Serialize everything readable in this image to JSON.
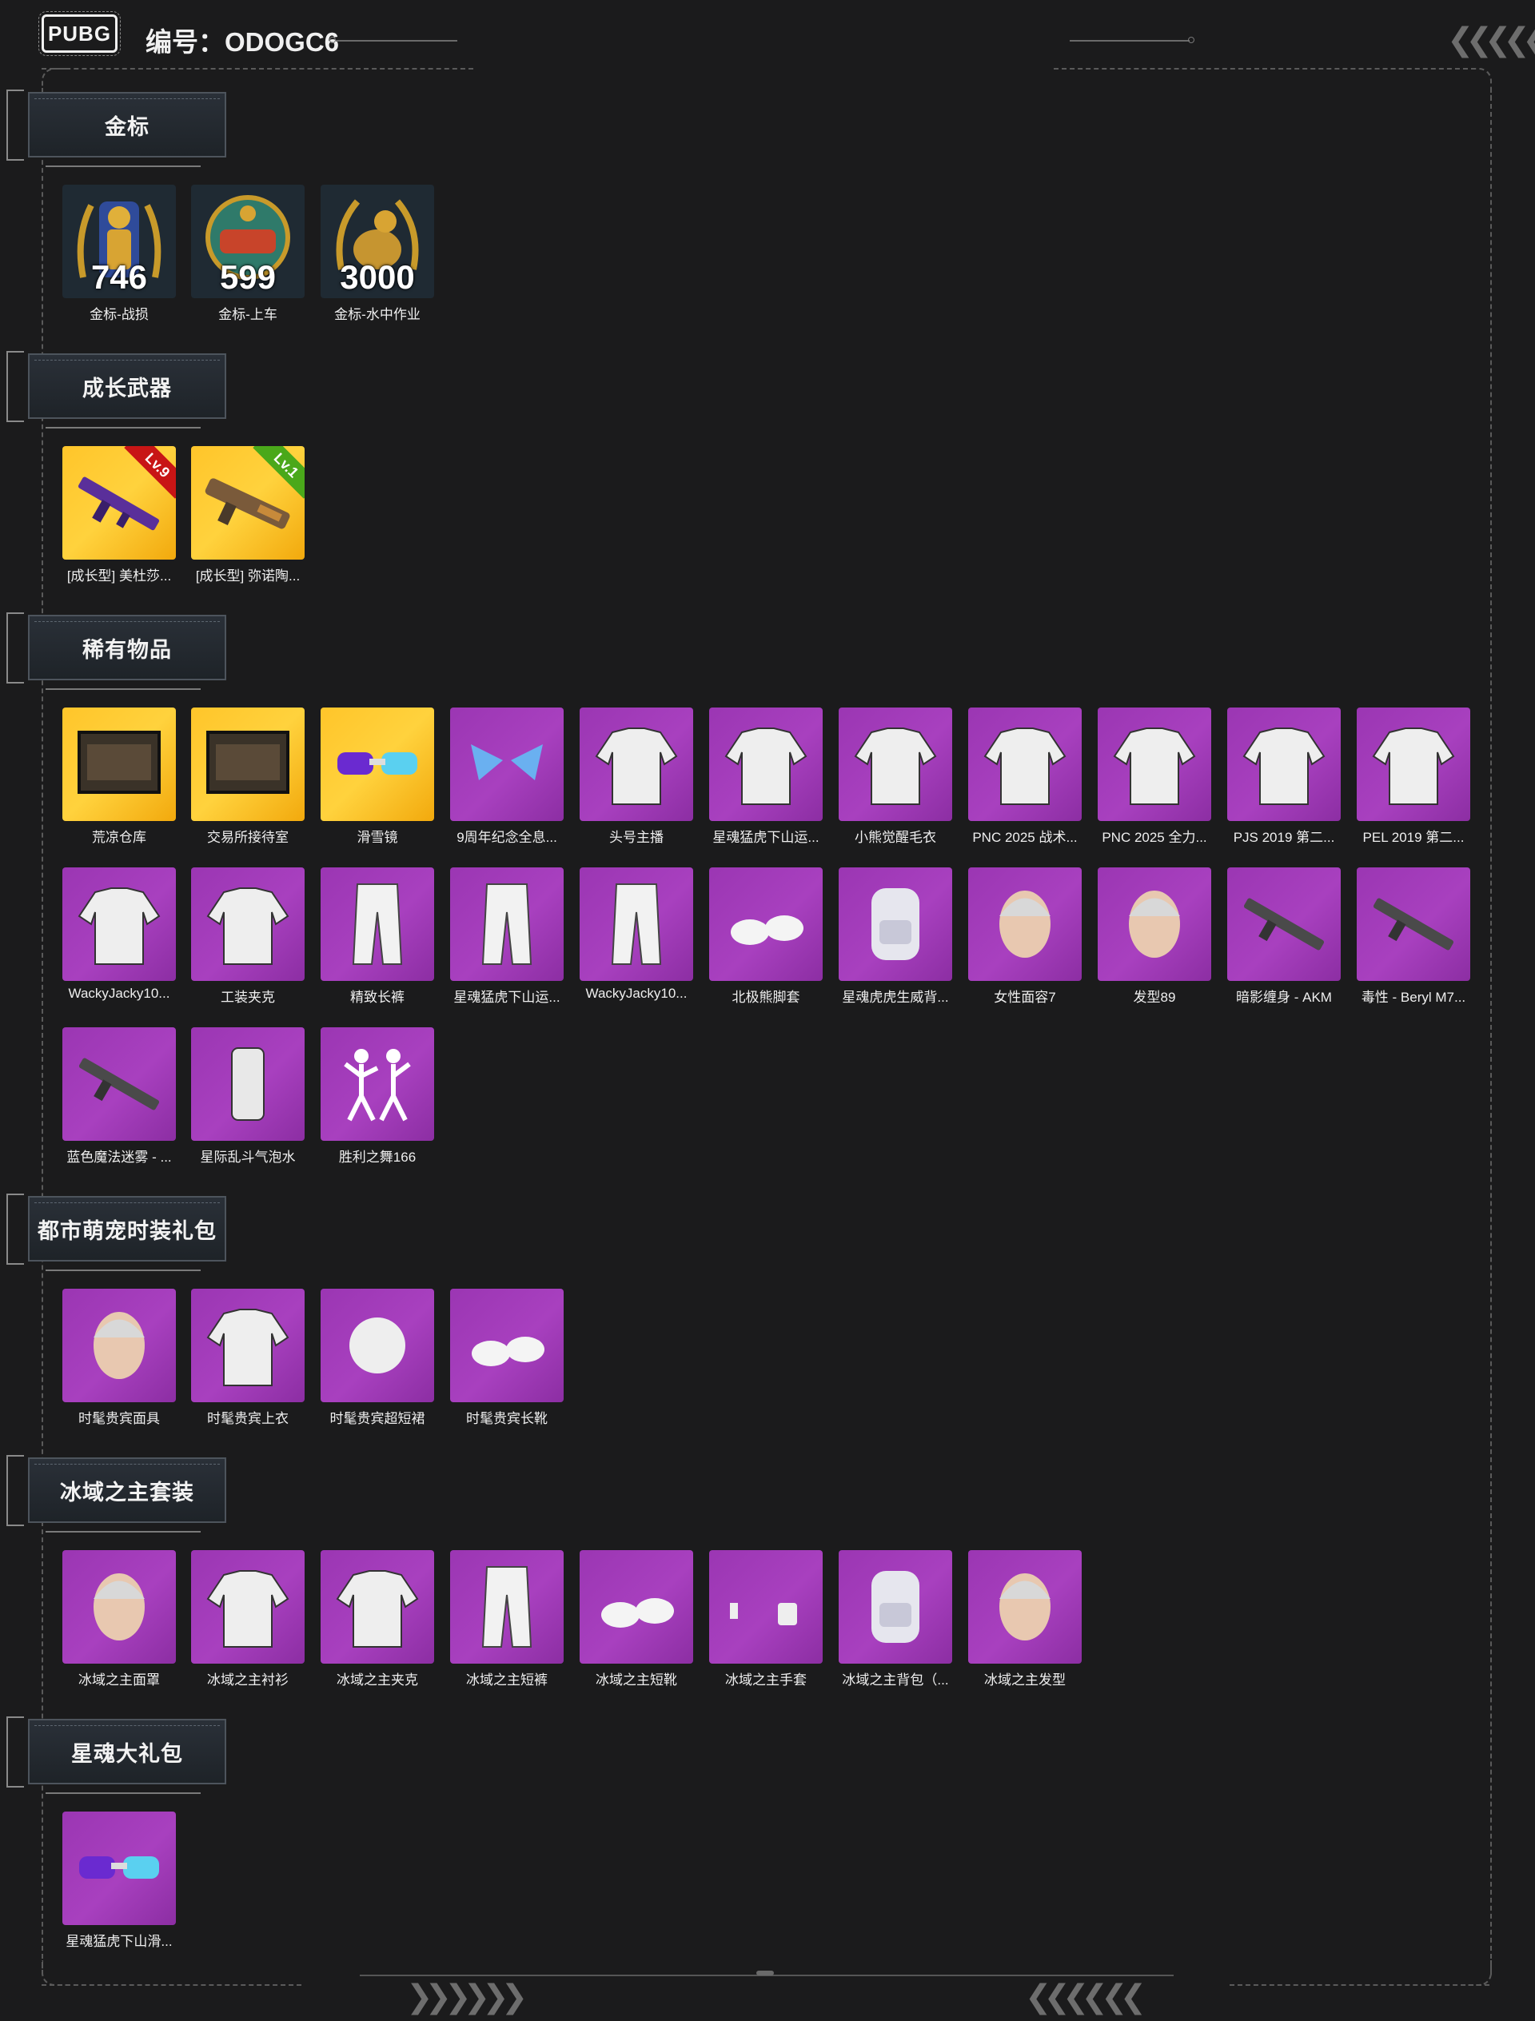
{
  "header": {
    "logo_text": "PUBG",
    "account_label": "编号：ODOGC6",
    "right_arrows": "❮❮❮❮❮",
    "bottom_left_arrows": "❯❯ ❯❯❯❯",
    "bottom_right_arrows": "❮❮❮❮ ❮❮"
  },
  "colors": {
    "background": "#1b1b1c",
    "tile_purple": "#a33dba",
    "tile_gold": "#ffc52a",
    "badge_red": "#c81515",
    "badge_green": "#4aa81a"
  },
  "sections": [
    {
      "title": "金标",
      "items": [
        {
          "label": "金标-战损",
          "count": "746",
          "icon": "gold-soldier-badge-icon"
        },
        {
          "label": "金标-上车",
          "count": "599",
          "icon": "gold-car-badge-icon"
        },
        {
          "label": "金标-水中作业",
          "count": "3000",
          "icon": "gold-seal-badge-icon"
        }
      ]
    },
    {
      "title": "成长武器",
      "items": [
        {
          "label": "[成长型] 美杜莎...",
          "level": "Lv.9",
          "icon": "growth-rifle-icon"
        },
        {
          "label": "[成长型] 弥诺陶...",
          "level": "Lv.1",
          "icon": "growth-smg-icon"
        }
      ]
    },
    {
      "title": "稀有物品",
      "items": [
        {
          "label": "荒凉仓库",
          "icon": "warehouse-scene-icon"
        },
        {
          "label": "交易所接待室",
          "icon": "reception-room-scene-icon"
        },
        {
          "label": "滑雪镜",
          "icon": "ski-goggles-icon"
        },
        {
          "label": "9周年纪念全息...",
          "icon": "hologram-ears-icon"
        },
        {
          "label": "头号主播",
          "icon": "streamer-tshirt-icon"
        },
        {
          "label": "星魂猛虎下山运...",
          "icon": "tiger-sport-jacket-icon"
        },
        {
          "label": "小熊觉醒毛衣",
          "icon": "bear-sweater-icon"
        },
        {
          "label": "PNC 2025 战术...",
          "icon": "pnc-tactical-top-icon"
        },
        {
          "label": "PNC 2025 全力...",
          "icon": "pnc-jacket-icon"
        },
        {
          "label": "PJS 2019 第二...",
          "icon": "pjs-jacket-icon"
        },
        {
          "label": "PEL 2019 第二...",
          "icon": "pel-jacket-icon"
        },
        {
          "label": "WackyJacky10...",
          "icon": "wacky-hoodie-icon"
        },
        {
          "label": "工装夹克",
          "icon": "work-jacket-icon"
        },
        {
          "label": "精致长裤",
          "icon": "white-pants-icon"
        },
        {
          "label": "星魂猛虎下山运...",
          "icon": "tiger-sport-pants-icon"
        },
        {
          "label": "WackyJacky10...",
          "icon": "wacky-pants-icon"
        },
        {
          "label": "北极熊脚套",
          "icon": "polar-bear-feet-icon"
        },
        {
          "label": "星魂虎虎生威背...",
          "icon": "tiger-backpack-icon"
        },
        {
          "label": "女性面容7",
          "icon": "female-face-icon"
        },
        {
          "label": "发型89",
          "icon": "hairstyle-icon"
        },
        {
          "label": "暗影缠身 - AKM",
          "icon": "akm-skin-icon"
        },
        {
          "label": "毒性 - Beryl M7...",
          "icon": "beryl-skin-icon"
        },
        {
          "label": "蓝色魔法迷雾 - ...",
          "icon": "magic-smoke-weapon-icon"
        },
        {
          "label": "星际乱斗气泡水",
          "icon": "soda-can-icon"
        },
        {
          "label": "胜利之舞166",
          "icon": "victory-dance-icon"
        }
      ]
    },
    {
      "title": "都市萌宠时装礼包",
      "items": [
        {
          "label": "时髦贵宾面具",
          "icon": "poodle-mask-icon"
        },
        {
          "label": "时髦贵宾上衣",
          "icon": "poodle-top-icon"
        },
        {
          "label": "时髦贵宾超短裙",
          "icon": "poodle-skirt-icon"
        },
        {
          "label": "时髦贵宾长靴",
          "icon": "poodle-boots-icon"
        }
      ]
    },
    {
      "title": "冰域之主套装",
      "items": [
        {
          "label": "冰域之主面罩",
          "icon": "ice-mask-icon"
        },
        {
          "label": "冰域之主衬衫",
          "icon": "ice-shirt-icon"
        },
        {
          "label": "冰域之主夹克",
          "icon": "ice-jacket-icon"
        },
        {
          "label": "冰域之主短裤",
          "icon": "ice-shorts-icon"
        },
        {
          "label": "冰域之主短靴",
          "icon": "ice-boots-icon"
        },
        {
          "label": "冰域之主手套",
          "icon": "ice-gloves-icon"
        },
        {
          "label": "冰域之主背包（...",
          "icon": "ice-backpack-icon"
        },
        {
          "label": "冰域之主发型",
          "icon": "ice-hairstyle-icon"
        }
      ]
    },
    {
      "title": "星魂大礼包",
      "items": [
        {
          "label": "星魂猛虎下山滑...",
          "icon": "tiger-goggles-icon"
        }
      ]
    }
  ]
}
